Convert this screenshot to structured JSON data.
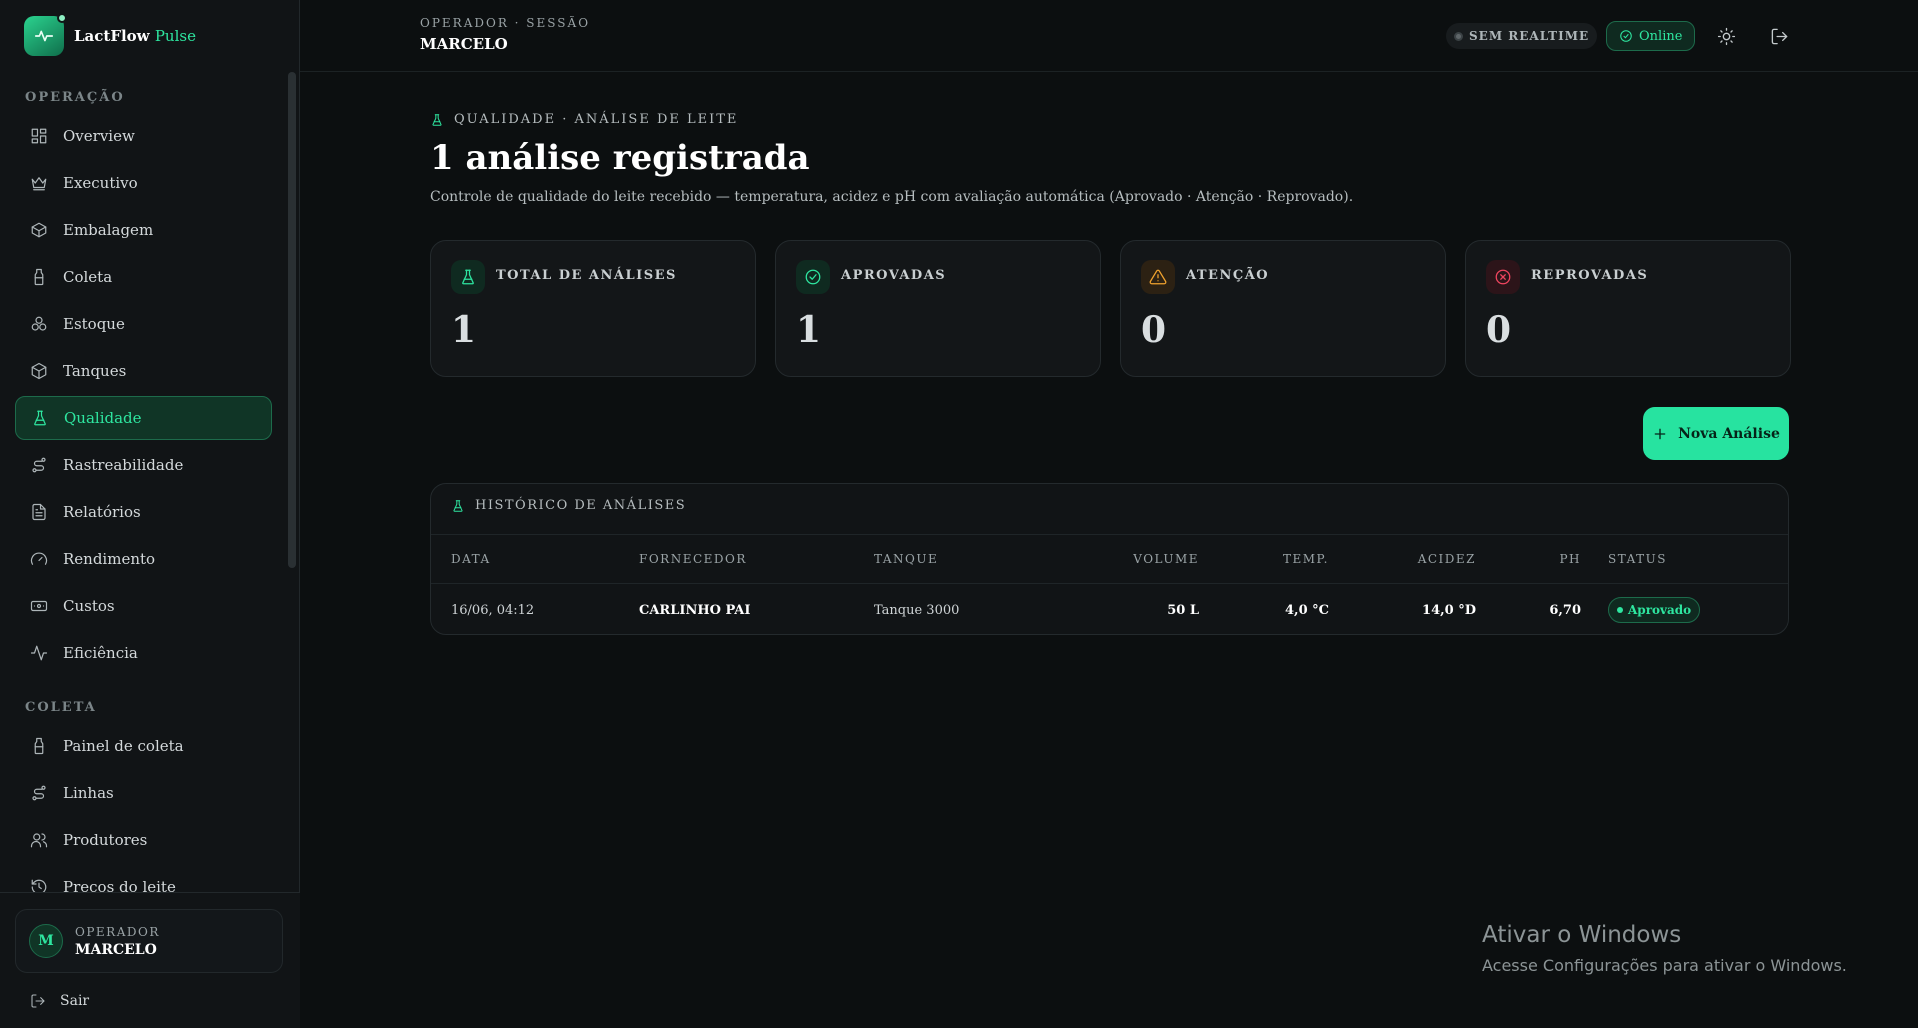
{
  "brand": {
    "name": "LactFlow",
    "accent": "Pulse"
  },
  "sidebar": {
    "sections": [
      {
        "title": "OPERAÇÃO"
      },
      {
        "title": "COLETA"
      }
    ],
    "items": [
      {
        "label": "Overview",
        "icon": "grid-icon"
      },
      {
        "label": "Executivo",
        "icon": "crown-icon"
      },
      {
        "label": "Embalagem",
        "icon": "package-icon"
      },
      {
        "label": "Coleta",
        "icon": "milk-bottle-icon"
      },
      {
        "label": "Estoque",
        "icon": "boxes-icon"
      },
      {
        "label": "Tanques",
        "icon": "cube-icon"
      },
      {
        "label": "Qualidade",
        "icon": "flask-icon",
        "active": true
      },
      {
        "label": "Rastreabilidade",
        "icon": "route-icon"
      },
      {
        "label": "Relatórios",
        "icon": "file-text-icon"
      },
      {
        "label": "Rendimento",
        "icon": "gauge-icon"
      },
      {
        "label": "Custos",
        "icon": "banknote-icon"
      },
      {
        "label": "Eficiência",
        "icon": "activity-icon"
      },
      {
        "label": "Painel de coleta",
        "icon": "milk-bottle-icon"
      },
      {
        "label": "Linhas",
        "icon": "route-icon"
      },
      {
        "label": "Produtores",
        "icon": "users-icon"
      },
      {
        "label": "Preços do leite",
        "icon": "history-icon"
      }
    ],
    "operator": {
      "initial": "M",
      "role": "OPERADOR",
      "name": "MARCELO"
    },
    "logout_label": "Sair"
  },
  "topbar": {
    "session_label": "OPERADOR · SESSÃO",
    "session_name": "MARCELO",
    "realtime_label": "SEM REALTIME",
    "online_label": "Online"
  },
  "page": {
    "eyebrow": "QUALIDADE · ANÁLISE DE LEITE",
    "title": "1 análise registrada",
    "subtitle": "Controle de qualidade do leite recebido — temperatura, acidez e pH com avaliação automática (Aprovado · Atenção · Reprovado)."
  },
  "stats": [
    {
      "label": "TOTAL DE ANÁLISES",
      "value": "1",
      "icon": "flask-icon",
      "color": "#2ee6a0"
    },
    {
      "label": "APROVADAS",
      "value": "1",
      "icon": "check-circle-icon",
      "color": "#2ee6a0"
    },
    {
      "label": "ATENÇÃO",
      "value": "0",
      "icon": "warning-icon",
      "color": "#f0a22e"
    },
    {
      "label": "REPROVADAS",
      "value": "0",
      "icon": "x-circle-icon",
      "color": "#f0455f"
    }
  ],
  "new_button_label": "Nova Análise",
  "history": {
    "title": "HISTÓRICO DE ANÁLISES",
    "columns": [
      "DATA",
      "FORNECEDOR",
      "TANQUE",
      "VOLUME",
      "TEMP.",
      "ACIDEZ",
      "PH",
      "STATUS"
    ],
    "rows": [
      {
        "data": "16/06, 04:12",
        "fornecedor": "CARLINHO PAI",
        "tanque": "Tanque 3000",
        "volume": "50 L",
        "temp": "4,0 °C",
        "acidez": "14,0 °D",
        "ph": "6,70",
        "status": "Aprovado"
      }
    ]
  },
  "watermark": {
    "title": "Ativar o Windows",
    "subtitle": "Acesse Configurações para ativar o Windows."
  }
}
